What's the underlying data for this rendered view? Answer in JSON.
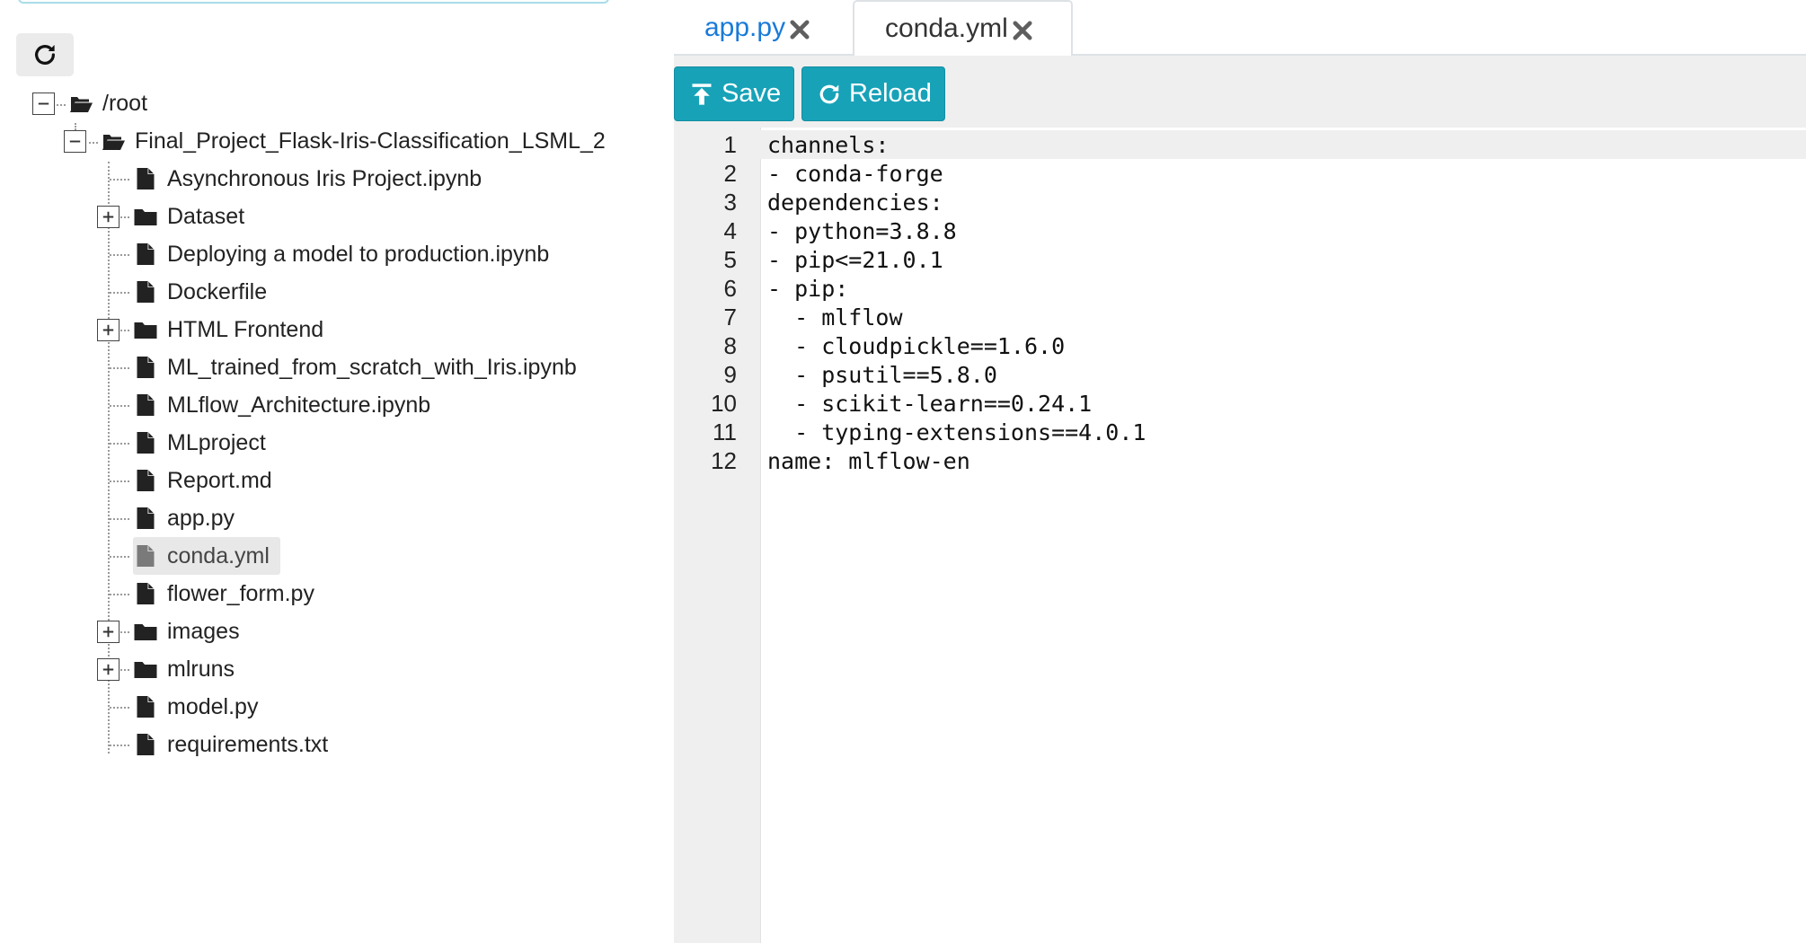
{
  "file_tree": {
    "refresh_icon": "refresh-icon",
    "root": {
      "label": "/root",
      "icon": "folder-open-icon",
      "expanded": true
    },
    "project": {
      "label": "Final_Project_Flask-Iris-Classification_LSML_2",
      "icon": "folder-open-icon",
      "expanded": true
    },
    "items": [
      {
        "label": "Asynchronous Iris Project.ipynb",
        "type": "file",
        "icon": "file-icon"
      },
      {
        "label": "Dataset",
        "type": "folder",
        "icon": "folder-icon"
      },
      {
        "label": "Deploying a model to production.ipynb",
        "type": "file",
        "icon": "file-icon"
      },
      {
        "label": "Dockerfile",
        "type": "file",
        "icon": "file-icon"
      },
      {
        "label": "HTML Frontend",
        "type": "folder",
        "icon": "folder-icon"
      },
      {
        "label": "ML_trained_from_scratch_with_Iris.ipynb",
        "type": "file",
        "icon": "file-icon"
      },
      {
        "label": "MLflow_Architecture.ipynb",
        "type": "file",
        "icon": "file-icon"
      },
      {
        "label": "MLproject",
        "type": "file",
        "icon": "file-icon"
      },
      {
        "label": "Report.md",
        "type": "file",
        "icon": "file-icon"
      },
      {
        "label": "app.py",
        "type": "file",
        "icon": "file-icon"
      },
      {
        "label": "conda.yml",
        "type": "file",
        "icon": "file-icon",
        "selected": true
      },
      {
        "label": "flower_form.py",
        "type": "file",
        "icon": "file-icon"
      },
      {
        "label": "images",
        "type": "folder",
        "icon": "folder-icon"
      },
      {
        "label": "mlruns",
        "type": "folder",
        "icon": "folder-icon"
      },
      {
        "label": "model.py",
        "type": "file",
        "icon": "file-icon"
      },
      {
        "label": "requirements.txt",
        "type": "file",
        "icon": "file-icon"
      }
    ]
  },
  "editor": {
    "tabs": [
      {
        "label": "app.py",
        "active": false,
        "close_icon": "close-icon"
      },
      {
        "label": "conda.yml",
        "active": true,
        "close_icon": "close-icon"
      }
    ],
    "toolbar": {
      "save_label": "Save",
      "save_icon": "upload-icon",
      "reload_label": "Reload",
      "reload_icon": "refresh-icon",
      "button_color": "#17a2b8"
    },
    "active_line": 1,
    "lines": [
      "channels:",
      "- conda-forge",
      "dependencies:",
      "- python=3.8.8",
      "- pip<=21.0.1",
      "- pip:",
      "  - mlflow",
      "  - cloudpickle==1.6.0",
      "  - psutil==5.8.0",
      "  - scikit-learn==0.24.1",
      "  - typing-extensions==4.0.1",
      "name: mlflow-en"
    ]
  }
}
